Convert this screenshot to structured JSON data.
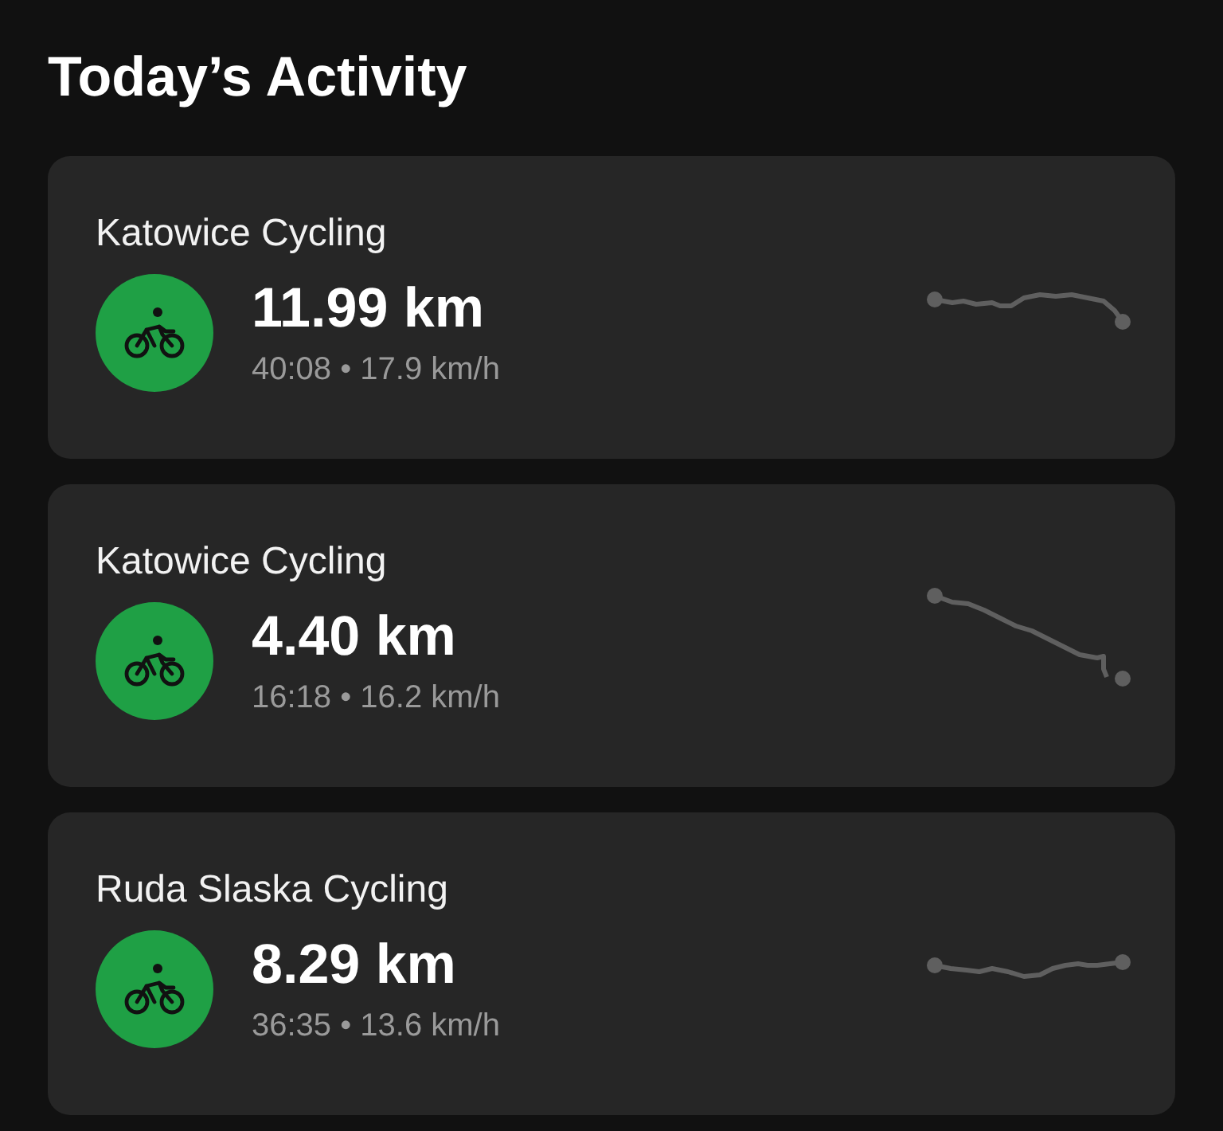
{
  "header": {
    "title": "Today’s Activity"
  },
  "activities": [
    {
      "name": "Katowice Cycling",
      "kind": "cycling",
      "distance": "11.99 km",
      "details": "40:08 • 17.9 km/h"
    },
    {
      "name": "Katowice Cycling",
      "kind": "cycling",
      "distance": "4.40 km",
      "details": "16:18 • 16.2 km/h"
    },
    {
      "name": "Ruda Slaska Cycling",
      "kind": "cycling",
      "distance": "8.29 km",
      "details": "36:35 • 13.6 km/h"
    }
  ]
}
